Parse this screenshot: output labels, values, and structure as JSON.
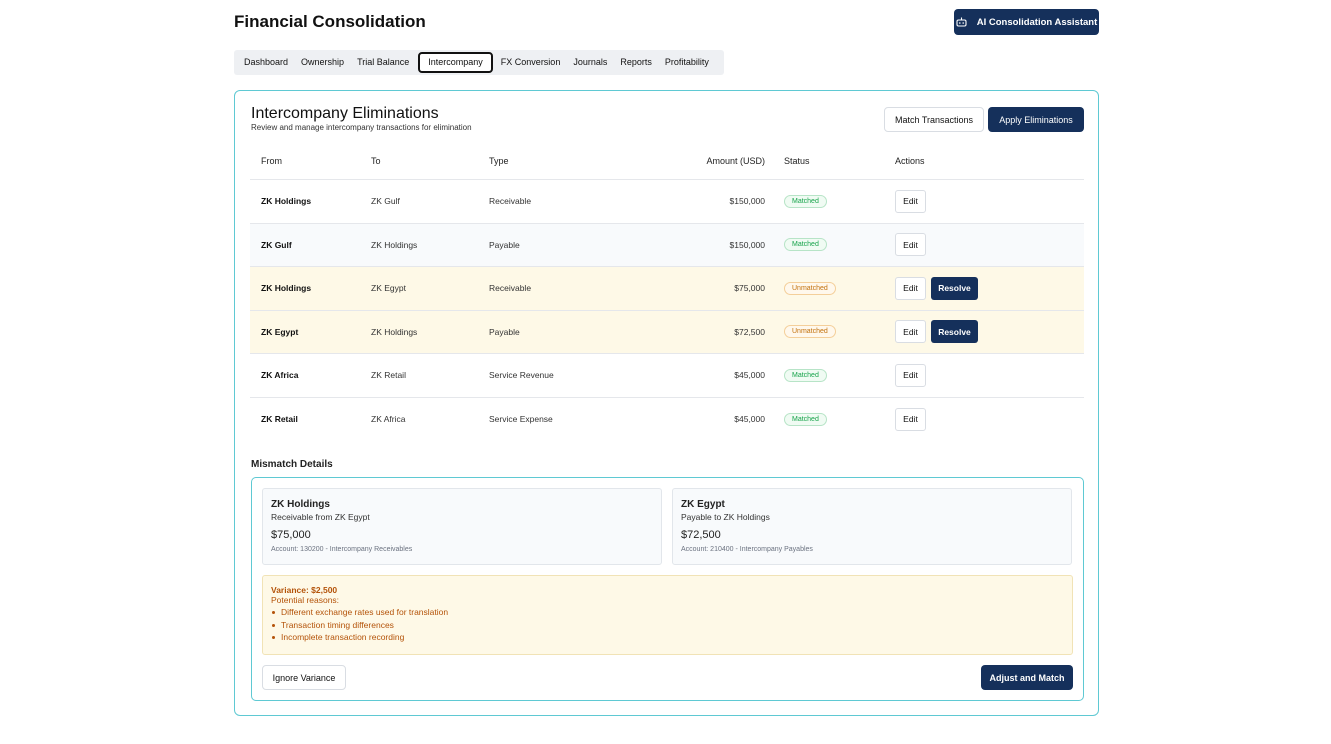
{
  "header": {
    "title": "Financial Consolidation",
    "ai_button_label": "AI Consolidation Assistant",
    "ai_button_icon": "robot-icon"
  },
  "tabs": [
    {
      "label": "Dashboard",
      "active": false
    },
    {
      "label": "Ownership",
      "active": false
    },
    {
      "label": "Trial Balance",
      "active": false
    },
    {
      "label": "Intercompany",
      "active": true
    },
    {
      "label": "FX Conversion",
      "active": false
    },
    {
      "label": "Journals",
      "active": false
    },
    {
      "label": "Reports",
      "active": false
    },
    {
      "label": "Profitability",
      "active": false
    }
  ],
  "eliminations": {
    "title": "Intercompany Eliminations",
    "subtitle": "Review and manage intercompany transactions for elimination",
    "match_button": "Match Transactions",
    "apply_button": "Apply Eliminations",
    "columns": {
      "from": "From",
      "to": "To",
      "type": "Type",
      "amount": "Amount (USD)",
      "status": "Status",
      "actions": "Actions"
    },
    "rows": [
      {
        "from": "ZK Holdings",
        "to": "ZK Gulf",
        "type": "Receivable",
        "amount": "$150,000",
        "status": "Matched",
        "edit": "Edit",
        "resolve": ""
      },
      {
        "from": "ZK Gulf",
        "to": "ZK Holdings",
        "type": "Payable",
        "amount": "$150,000",
        "status": "Matched",
        "edit": "Edit",
        "resolve": ""
      },
      {
        "from": "ZK Holdings",
        "to": "ZK Egypt",
        "type": "Receivable",
        "amount": "$75,000",
        "status": "Unmatched",
        "edit": "Edit",
        "resolve": "Resolve"
      },
      {
        "from": "ZK Egypt",
        "to": "ZK Holdings",
        "type": "Payable",
        "amount": "$72,500",
        "status": "Unmatched",
        "edit": "Edit",
        "resolve": "Resolve"
      },
      {
        "from": "ZK Africa",
        "to": "ZK Retail",
        "type": "Service Revenue",
        "amount": "$45,000",
        "status": "Matched",
        "edit": "Edit",
        "resolve": ""
      },
      {
        "from": "ZK Retail",
        "to": "ZK Africa",
        "type": "Service Expense",
        "amount": "$45,000",
        "status": "Matched",
        "edit": "Edit",
        "resolve": ""
      }
    ]
  },
  "mismatch": {
    "title": "Mismatch Details",
    "left": {
      "name": "ZK Holdings",
      "desc": "Receivable from ZK Egypt",
      "amount": "$75,000",
      "account": "Account: 130200 - Intercompany Receivables"
    },
    "right": {
      "name": "ZK Egypt",
      "desc": "Payable to ZK Holdings",
      "amount": "$72,500",
      "account": "Account: 210400 - Intercompany Payables"
    },
    "variance_title": "Variance: $2,500",
    "reasons_label": "Potential reasons:",
    "reasons": [
      "Different exchange rates used for translation",
      "Transaction timing differences",
      "Incomplete transaction recording"
    ],
    "ignore_button": "Ignore Variance",
    "adjust_button": "Adjust and Match"
  },
  "colors": {
    "primary": "#15305b",
    "accent_border": "#5fc9d3",
    "matched": "#16a34a",
    "unmatched": "#c2710c",
    "warning_bg": "#fef9e7"
  }
}
